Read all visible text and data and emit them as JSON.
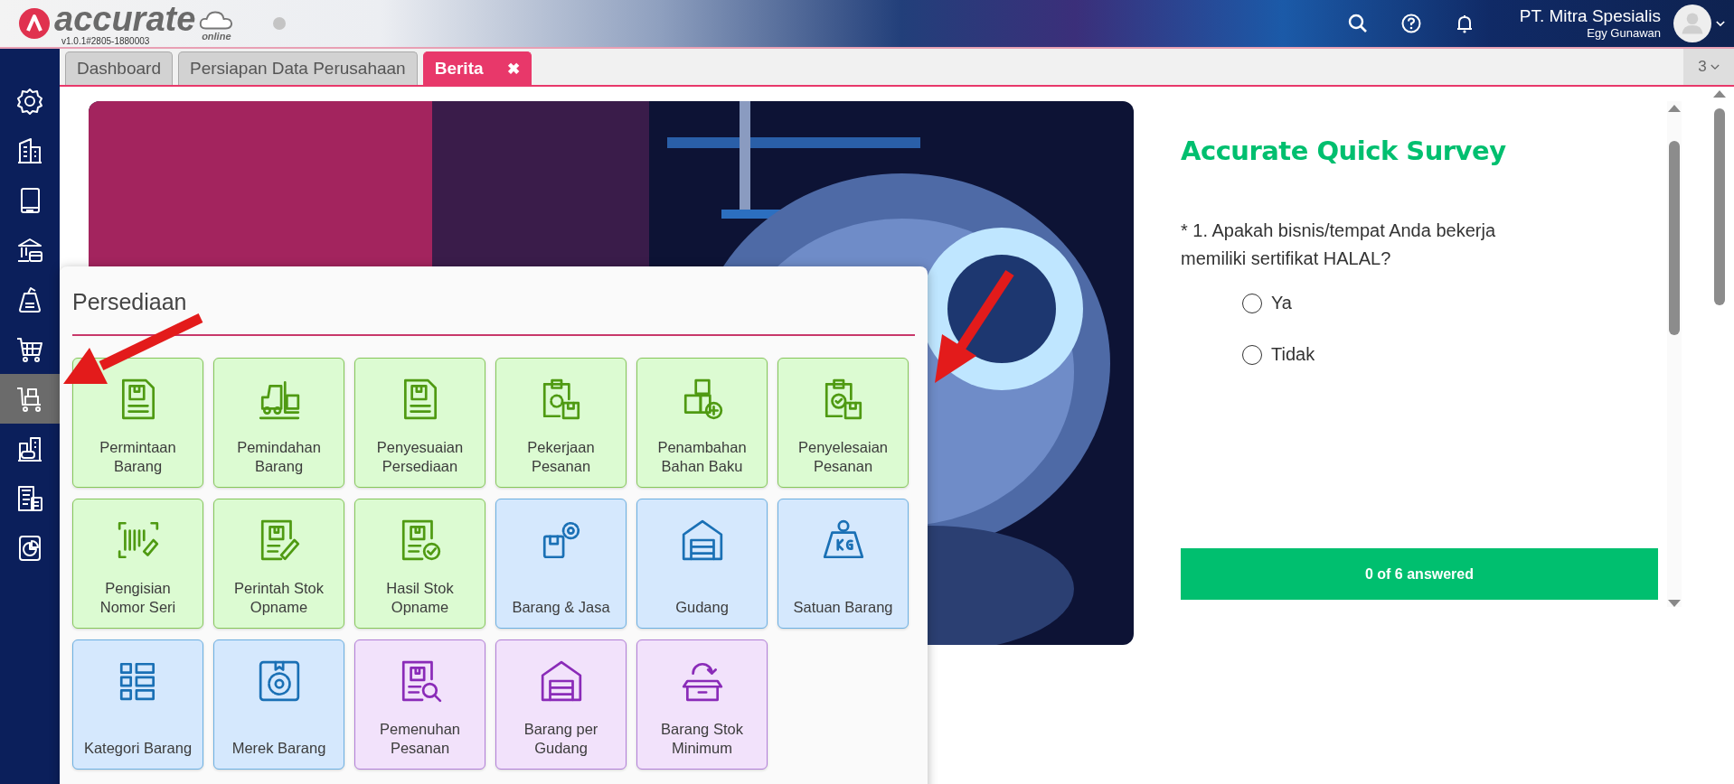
{
  "header": {
    "logo_text": "accurate",
    "logo_sub": "online",
    "version": "v1.0.1#2805-1880003",
    "company": "PT. Mitra Spesialis",
    "user": "Egy Gunawan"
  },
  "sidebar": {
    "items": [
      {
        "selected": false
      },
      {
        "selected": false
      },
      {
        "selected": false
      },
      {
        "selected": false
      },
      {
        "selected": false
      },
      {
        "selected": false
      },
      {
        "selected": true
      },
      {
        "selected": false
      },
      {
        "selected": false
      },
      {
        "selected": false
      }
    ]
  },
  "tabs": [
    {
      "label": "Dashboard",
      "selected": false
    },
    {
      "label": "Persiapan Data Perusahaan",
      "selected": false
    },
    {
      "label": "Berita",
      "selected": true,
      "close_icon": "✖"
    }
  ],
  "tab_count": "3",
  "menu": {
    "title": "Persediaan",
    "tiles": [
      {
        "label": "Permintaan\nBarang",
        "kind": "transaction"
      },
      {
        "label": "Pemindahan\nBarang",
        "kind": "transaction"
      },
      {
        "label": "Penyesuaian\nPersediaan",
        "kind": "transaction"
      },
      {
        "label": "Pekerjaan\nPesanan",
        "kind": "transaction"
      },
      {
        "label": "Penambahan\nBahan Baku",
        "kind": "transaction"
      },
      {
        "label": "Penyelesaian\nPesanan",
        "kind": "transaction"
      },
      {
        "label": "Pengisian\nNomor Seri",
        "kind": "transaction"
      },
      {
        "label": "Perintah Stok\nOpname",
        "kind": "transaction"
      },
      {
        "label": "Hasil Stok\nOpname",
        "kind": "transaction"
      },
      {
        "label": "Barang & Jasa",
        "kind": "master"
      },
      {
        "label": "Gudang",
        "kind": "master"
      },
      {
        "label": "Satuan Barang",
        "kind": "master"
      },
      {
        "label": "Kategori Barang",
        "kind": "master"
      },
      {
        "label": "Merek Barang",
        "kind": "master"
      },
      {
        "label": "Pemenuhan\nPesanan",
        "kind": "report"
      },
      {
        "label": "Barang per\nGudang",
        "kind": "report"
      },
      {
        "label": "Barang Stok\nMinimum",
        "kind": "report"
      }
    ]
  },
  "survey": {
    "title": "Accurate Quick Survey",
    "question": "* 1. Apakah bisnis/tempat Anda bekerja memiliki sertifikat HALAL?",
    "options": [
      {
        "label": "Ya",
        "selected": false
      },
      {
        "label": "Tidak",
        "selected": false
      }
    ],
    "progress": "0 of 6 answered"
  }
}
